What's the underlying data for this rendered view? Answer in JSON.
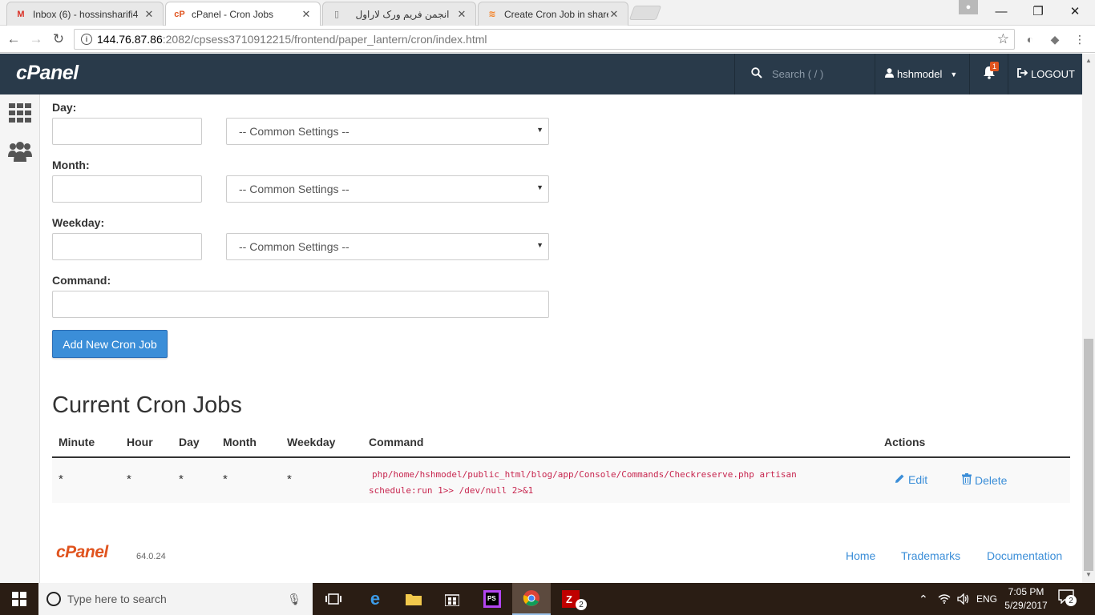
{
  "browser": {
    "tabs": [
      {
        "title": "Inbox (6) - hossinsharifi4",
        "favicon": "gmail-icon"
      },
      {
        "title": "cPanel - Cron Jobs",
        "favicon": "cpanel-icon"
      },
      {
        "title": "انجمن فریم ورک لاراول",
        "favicon": "page-icon"
      },
      {
        "title": "Create Cron Job in share",
        "favicon": "stack-icon"
      }
    ],
    "url_host": "144.76.87.86",
    "url_path": ":2082/cpsess3710912215/frontend/paper_lantern/cron/index.html"
  },
  "header": {
    "logo": "cPanel",
    "search_placeholder": "Search ( / )",
    "username": "hshmodel",
    "notification_count": "1",
    "logout_label": "LOGOUT"
  },
  "form": {
    "day_label": "Day:",
    "month_label": "Month:",
    "weekday_label": "Weekday:",
    "command_label": "Command:",
    "common_settings": "-- Common Settings --",
    "add_button": "Add New Cron Job"
  },
  "table": {
    "title": "Current Cron Jobs",
    "headers": [
      "Minute",
      "Hour",
      "Day",
      "Month",
      "Weekday",
      "Command",
      "Actions"
    ],
    "rows": [
      {
        "minute": "*",
        "hour": "*",
        "day": "*",
        "month": "*",
        "weekday": "*",
        "command_line1": "php/home/hshmodel/public_html/blog/app/Console/Commands/Checkreserve.php artisan",
        "command_line2": "schedule:run 1>> /dev/null 2>&1",
        "edit": "Edit",
        "delete": "Delete"
      }
    ]
  },
  "footer": {
    "logo": "cPanel",
    "version": "64.0.24",
    "links": [
      "Home",
      "Trademarks",
      "Documentation"
    ]
  },
  "taskbar": {
    "search_placeholder": "Type here to search",
    "language": "ENG",
    "time": "7:05 PM",
    "date": "5/29/2017",
    "notification_count": "2",
    "app_badge": "2"
  },
  "colors": {
    "header_bg": "#293a4a",
    "accent": "#3b8ed8",
    "brand_orange": "#e0541f",
    "code_text": "#c7254e"
  }
}
